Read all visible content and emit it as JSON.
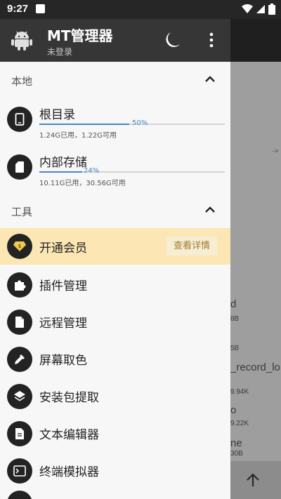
{
  "status_bar": {
    "time": "9:27"
  },
  "background_page": {
    "texts": [
      "->",
      "d",
      "8B",
      "5B",
      "_record_lo",
      "9.94K",
      "o",
      "9.22K",
      "ne",
      "30B"
    ]
  },
  "drawer": {
    "app_title": "MT管理器",
    "login_status": "未登录",
    "local_section": {
      "label": "本地",
      "items": [
        {
          "name": "根目录",
          "usage_percent": 50,
          "percent_label": "50%",
          "detail": "1.24G已用，1.22G可用"
        },
        {
          "name": "内部存储",
          "usage_percent": 24,
          "percent_label": "24%",
          "detail": "10.11G已用，30.56G可用"
        }
      ]
    },
    "tools_section": {
      "label": "工具",
      "vip": {
        "label": "开通会员",
        "button": "查看详情"
      },
      "items": [
        {
          "label": "插件管理",
          "icon": "puzzle-icon"
        },
        {
          "label": "远程管理",
          "icon": "file-icon"
        },
        {
          "label": "屏幕取色",
          "icon": "eyedropper-icon"
        },
        {
          "label": "安装包提取",
          "icon": "layers-icon"
        },
        {
          "label": "文本编辑器",
          "icon": "text-file-icon"
        },
        {
          "label": "终端模拟器",
          "icon": "terminal-icon"
        }
      ]
    }
  },
  "colors": {
    "accent": "#4a86c5",
    "vip_bg": "#fce7b4",
    "header_bg": "#363636"
  }
}
